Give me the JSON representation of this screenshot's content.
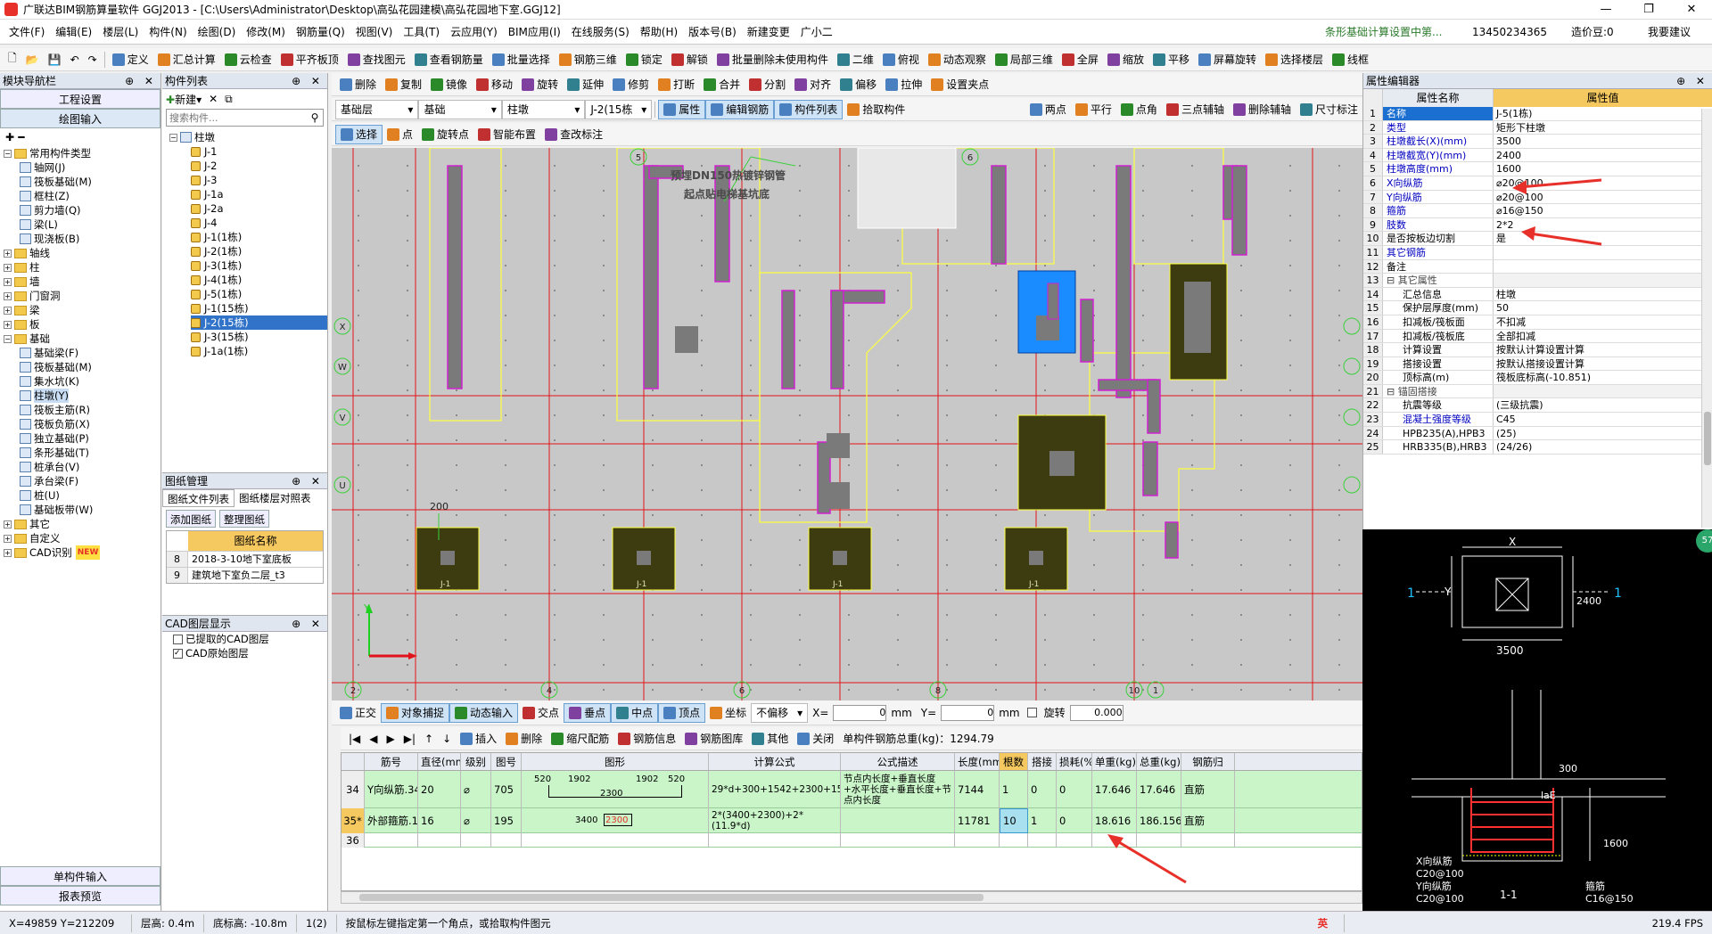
{
  "window": {
    "title": "广联达BIM钢筋算量软件 GGJ2013 - [C:\\Users\\Administrator\\Desktop\\高弘花园建模\\高弘花园地下室.GGJ12]"
  },
  "menu": [
    "文件(F)",
    "编辑(E)",
    "楼层(L)",
    "构件(N)",
    "绘图(D)",
    "修改(M)",
    "钢筋量(Q)",
    "视图(V)",
    "工具(T)",
    "云应用(Y)",
    "BIM应用(I)",
    "在线服务(S)",
    "帮助(H)",
    "版本号(B)",
    "新建变更",
    "广小二"
  ],
  "menu_right": {
    "tip": "条形基础计算设置中第...",
    "phone": "13450234365",
    "coins": "造价豆:0",
    "suggest": "我要建议"
  },
  "toolbar1": [
    "定义",
    "汇总计算",
    "云检查",
    "平齐板顶",
    "查找图元",
    "查看钢筋量",
    "批量选择",
    "钢筋三维",
    "锁定",
    "解锁",
    "批量删除未使用构件",
    "二维",
    "俯视",
    "动态观察",
    "局部三维",
    "全屏",
    "缩放",
    "平移",
    "屏幕旋转",
    "选择楼层",
    "线框"
  ],
  "toolbar2": [
    "删除",
    "复制",
    "镜像",
    "移动",
    "旋转",
    "延伸",
    "修剪",
    "打断",
    "合并",
    "分割",
    "对齐",
    "偏移",
    "拉伸",
    "设置夹点"
  ],
  "toolbar3": {
    "layer": "基础层",
    "category": "基础",
    "type": "柱墩",
    "component": "J-2(15栋",
    "buttons": [
      "属性",
      "编辑钢筋",
      "构件列表",
      "拾取构件"
    ],
    "right_buttons": [
      "两点",
      "平行",
      "点角",
      "三点辅轴",
      "删除辅轴",
      "尺寸标注"
    ]
  },
  "toolbar4": [
    "选择",
    "点",
    "旋转点",
    "智能布置",
    "查改标注"
  ],
  "module_nav": {
    "title": "模块导航栏",
    "tabs": [
      "工程设置",
      "绘图输入"
    ],
    "tree": [
      {
        "label": "常用构件类型",
        "level": 0,
        "type": "folder",
        "expanded": true
      },
      {
        "label": "轴网(J)",
        "level": 1,
        "type": "item"
      },
      {
        "label": "筏板基础(M)",
        "level": 1,
        "type": "item"
      },
      {
        "label": "框柱(Z)",
        "level": 1,
        "type": "item"
      },
      {
        "label": "剪力墙(Q)",
        "level": 1,
        "type": "item"
      },
      {
        "label": "梁(L)",
        "level": 1,
        "type": "item"
      },
      {
        "label": "现浇板(B)",
        "level": 1,
        "type": "item"
      },
      {
        "label": "轴线",
        "level": 0,
        "type": "folder"
      },
      {
        "label": "柱",
        "level": 0,
        "type": "folder"
      },
      {
        "label": "墙",
        "level": 0,
        "type": "folder"
      },
      {
        "label": "门窗洞",
        "level": 0,
        "type": "folder"
      },
      {
        "label": "梁",
        "level": 0,
        "type": "folder"
      },
      {
        "label": "板",
        "level": 0,
        "type": "folder"
      },
      {
        "label": "基础",
        "level": 0,
        "type": "folder",
        "expanded": true
      },
      {
        "label": "基础梁(F)",
        "level": 1,
        "type": "item"
      },
      {
        "label": "筏板基础(M)",
        "level": 1,
        "type": "item"
      },
      {
        "label": "集水坑(K)",
        "level": 1,
        "type": "item"
      },
      {
        "label": "柱墩(Y)",
        "level": 1,
        "type": "item",
        "selected_light": true
      },
      {
        "label": "筏板主筋(R)",
        "level": 1,
        "type": "item"
      },
      {
        "label": "筏板负筋(X)",
        "level": 1,
        "type": "item"
      },
      {
        "label": "独立基础(P)",
        "level": 1,
        "type": "item"
      },
      {
        "label": "条形基础(T)",
        "level": 1,
        "type": "item"
      },
      {
        "label": "桩承台(V)",
        "level": 1,
        "type": "item"
      },
      {
        "label": "承台梁(F)",
        "level": 1,
        "type": "item"
      },
      {
        "label": "桩(U)",
        "level": 1,
        "type": "item"
      },
      {
        "label": "基础板带(W)",
        "level": 1,
        "type": "item"
      },
      {
        "label": "其它",
        "level": 0,
        "type": "folder"
      },
      {
        "label": "自定义",
        "level": 0,
        "type": "folder"
      },
      {
        "label": "CAD识别",
        "level": 0,
        "type": "folder",
        "badge": "NEW"
      }
    ],
    "bottom_buttons": [
      "单构件输入",
      "报表预览"
    ]
  },
  "component_list": {
    "title": "构件列表",
    "new_label": "新建",
    "search_placeholder": "搜索构件...",
    "root": "柱墩",
    "items": [
      "J-1",
      "J-2",
      "J-3",
      "J-1a",
      "J-2a",
      "J-4",
      "J-1(1栋)",
      "J-2(1栋)",
      "J-3(1栋)",
      "J-4(1栋)",
      "J-5(1栋)",
      "J-1(15栋)",
      "J-2(15栋)",
      "J-3(15栋)",
      "J-1a(1栋)"
    ],
    "selected_index": 12
  },
  "drawing_mgmt": {
    "title": "图纸管理",
    "tabs": [
      "图纸文件列表",
      "图纸楼层对照表"
    ],
    "buttons": [
      "添加图纸",
      "整理图纸"
    ],
    "col_header": "图纸名称",
    "rows": [
      {
        "no": "8",
        "name": "2018-3-10地下室底板"
      },
      {
        "no": "9",
        "name": "建筑地下室负二层_t3"
      }
    ]
  },
  "cad_layers": {
    "title": "CAD图层显示",
    "items": [
      "已提取的CAD图层",
      "CAD原始图层"
    ]
  },
  "canvas": {
    "annotations": [
      "预埋DN150热镀锌钢管",
      "起点贴电梯基坑底"
    ],
    "dim_label": "200",
    "axis_top": [
      "5",
      "6"
    ],
    "axis_left": [
      "X",
      "W",
      "V",
      "U"
    ],
    "axis_bottom": [
      "2",
      "4",
      "6",
      "8",
      "10",
      "1"
    ],
    "footing_labels": [
      "J-1",
      "J-1",
      "J-1",
      "J-1"
    ]
  },
  "snap_bar": {
    "buttons": [
      "正交",
      "对象捕捉",
      "动态输入",
      "交点",
      "垂点",
      "中点",
      "顶点",
      "坐标"
    ],
    "offset_mode": "不偏移",
    "x_label": "X=",
    "x_val": "0",
    "y_label": "Y=",
    "y_val": "0",
    "unit": "mm",
    "rotate_label": "旋转",
    "rotate_val": "0.000"
  },
  "rebar_bar": {
    "buttons": [
      "插入",
      "删除",
      "缩尺配筋",
      "钢筋信息",
      "钢筋图库",
      "其他",
      "关闭"
    ],
    "total": "单构件钢筋总重(kg)：1294.79"
  },
  "rebar_grid": {
    "headers": [
      "",
      "筋号",
      "直径(mm)",
      "级别",
      "图号",
      "图形",
      "计算公式",
      "公式描述",
      "长度(mm)",
      "根数",
      "搭接",
      "损耗(%)",
      "单重(kg)",
      "总重(kg)",
      "钢筋归"
    ],
    "rows": [
      {
        "no": "34",
        "name": "Y向纵筋.34",
        "dia": "20",
        "grade": "⌀",
        "fig": "705",
        "shape": [
          "520",
          "1902",
          "2300",
          "1902",
          "520"
        ],
        "formula": "29*d+300+1542+2300+1542+29*d+300",
        "desc": "节点内长度+垂直长度+水平长度+垂直长度+节点内长度",
        "len": "7144",
        "count": "1",
        "lap": "0",
        "loss": "0",
        "unit_w": "17.646",
        "total_w": "17.646",
        "cat": "直筋"
      },
      {
        "no": "35*",
        "name": "外部箍筋.1",
        "dia": "16",
        "grade": "⌀",
        "fig": "195",
        "shape": [
          "3400",
          "2300"
        ],
        "formula": "2*(3400+2300)+2*(11.9*d)",
        "desc": "",
        "len": "11781",
        "count": "10",
        "lap": "1",
        "loss": "0",
        "unit_w": "18.616",
        "total_w": "186.156",
        "cat": "直筋"
      },
      {
        "no": "36"
      }
    ]
  },
  "property_editor": {
    "title": "属性编辑器",
    "col_name": "属性名称",
    "col_value": "属性值",
    "rows": [
      {
        "no": "1",
        "name": "名称",
        "value": "J-5(1栋)",
        "style": "hl"
      },
      {
        "no": "2",
        "name": "类型",
        "value": "矩形下柱墩",
        "style": "blue"
      },
      {
        "no": "3",
        "name": "柱墩截长(X)(mm)",
        "value": "3500",
        "style": "blue"
      },
      {
        "no": "4",
        "name": "柱墩截宽(Y)(mm)",
        "value": "2400",
        "style": "blue"
      },
      {
        "no": "5",
        "name": "柱墩高度(mm)",
        "value": "1600",
        "style": "blue"
      },
      {
        "no": "6",
        "name": "X向纵筋",
        "value": "⌀20@100",
        "style": "blue"
      },
      {
        "no": "7",
        "name": "Y向纵筋",
        "value": "⌀20@100",
        "style": "blue"
      },
      {
        "no": "8",
        "name": "箍筋",
        "value": "⌀16@150",
        "style": "blue"
      },
      {
        "no": "9",
        "name": "肢数",
        "value": "2*2",
        "style": "blue"
      },
      {
        "no": "10",
        "name": "是否按板边切割",
        "value": "是",
        "style": ""
      },
      {
        "no": "11",
        "name": "其它钢筋",
        "value": "",
        "style": "blue"
      },
      {
        "no": "12",
        "name": "备注",
        "value": "",
        "style": ""
      },
      {
        "no": "13",
        "name": "⊟ 其它属性",
        "value": "",
        "style": "group"
      },
      {
        "no": "14",
        "name": "汇总信息",
        "value": "柱墩",
        "style": "indent"
      },
      {
        "no": "15",
        "name": "保护层厚度(mm)",
        "value": "50",
        "style": "indent"
      },
      {
        "no": "16",
        "name": "扣减板/筏板面",
        "value": "不扣减",
        "style": "indent"
      },
      {
        "no": "17",
        "name": "扣减板/筏板底",
        "value": "全部扣减",
        "style": "indent"
      },
      {
        "no": "18",
        "name": "计算设置",
        "value": "按默认计算设置计算",
        "style": "indent"
      },
      {
        "no": "19",
        "name": "搭接设置",
        "value": "按默认搭接设置计算",
        "style": "indent"
      },
      {
        "no": "20",
        "name": "顶标高(m)",
        "value": "筏板底标高(-10.851)",
        "style": "indent"
      },
      {
        "no": "21",
        "name": "⊟ 锚固搭接",
        "value": "",
        "style": "group"
      },
      {
        "no": "22",
        "name": "抗震等级",
        "value": "(三级抗震)",
        "style": "indent"
      },
      {
        "no": "23",
        "name": "混凝土强度等级",
        "value": "C45",
        "style": "indent-blue"
      },
      {
        "no": "24",
        "name": "HPB235(A),HPB3",
        "value": "(25)",
        "style": "indent"
      },
      {
        "no": "25",
        "name": "HRB335(B),HRB3",
        "value": "(24/26)",
        "style": "indent"
      }
    ]
  },
  "preview": {
    "x_label": "X",
    "y_label": "Y",
    "dim_x": "3500",
    "dim_y": "2400",
    "sec_mark": "1",
    "dim_300": "300",
    "lae": "laE",
    "dim_1600": "1600",
    "x_bar": "X向纵筋",
    "x_bar_spec": "C20@100",
    "y_bar": "Y向纵筋",
    "y_bar_spec": "C20@100",
    "stirrup": "箍筋",
    "stirrup_spec": "C16@150",
    "section": "1-1"
  },
  "status": {
    "coords": "X=49859 Y=212209",
    "floor_h": "层高: 0.4m",
    "bottom_elev": "底标高: -10.8m",
    "count": "1(2)",
    "hint": "按鼠标左键指定第一个角点，或拾取构件图元",
    "fps": "219.4 FPS",
    "ime": "英"
  },
  "colors": {
    "accent": "#1a6fd0",
    "canvas_bg": "#c8c8c8",
    "grid_red": "#e0141a",
    "wall_magenta": "#d020d0",
    "footing": "#3c3c10",
    "selected_footing": "#1a8cff",
    "row_green": "#c9f5c9"
  }
}
